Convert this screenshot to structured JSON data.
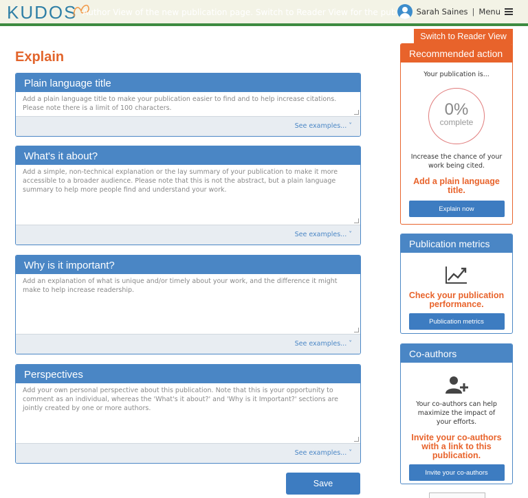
{
  "header": {
    "logo_text": "KUDOS",
    "banner_text": "Author View of the new publication page. Switch to Reader View for the public version",
    "user_name": "Sarah Saines",
    "separator": "|",
    "menu_label": "Menu"
  },
  "main": {
    "title": "Explain",
    "sections": [
      {
        "heading": "Plain language title",
        "placeholder": "Add a plain language title to make your publication easier to find and to help increase citations. Please note there is a limit of 100 characters.",
        "examples_label": "See examples... ˅"
      },
      {
        "heading": "What's it about?",
        "placeholder": "Add a simple, non-technical explanation or the lay summary of your publication to make it more accessible to a broader audience. Please note that this is not the abstract, but a plain language summary to help more people find and understand your work.",
        "examples_label": "See examples... ˅"
      },
      {
        "heading": "Why is it important?",
        "placeholder": "Add an explanation of what is unique and/or timely about your work, and the difference it might make to help increase readership.",
        "examples_label": "See examples... ˅"
      },
      {
        "heading": "Perspectives",
        "placeholder": "Add your own personal perspective about this publication. Note that this is your opportunity to comment as an individual, whereas the 'What's it about?' and 'Why is it Important?' sections are jointly created by one or more authors.",
        "examples_label": "See examples... ˅"
      }
    ],
    "save_label": "Save"
  },
  "sidebar": {
    "reader_view_label": "Switch to Reader View",
    "recommended": {
      "heading": "Recommended action",
      "intro": "Your publication is...",
      "percent": "0%",
      "percent_label": "complete",
      "body": "Increase the chance of your work being cited.",
      "cta": "Add a plain language title.",
      "button": "Explain now"
    },
    "metrics": {
      "heading": "Publication metrics",
      "cta": "Check your publication performance.",
      "button": "Publication metrics"
    },
    "coauthors": {
      "heading": "Co-authors",
      "body": "Your co-authors can help maximize the impact of your efforts.",
      "cta": "Invite your co-authors with a link to this publication.",
      "button": "Invite your co-authors"
    }
  },
  "colors": {
    "accent_orange": "#e8632b",
    "panel_blue": "#4a86c5",
    "header_bg": "#f3f3e6",
    "header_green": "#3d8b40"
  },
  "icons": [
    "butterfly-logo-icon",
    "user-avatar-icon",
    "hamburger-menu-icon",
    "chart-trend-icon",
    "add-user-icon",
    "chevron-down-icon"
  ]
}
